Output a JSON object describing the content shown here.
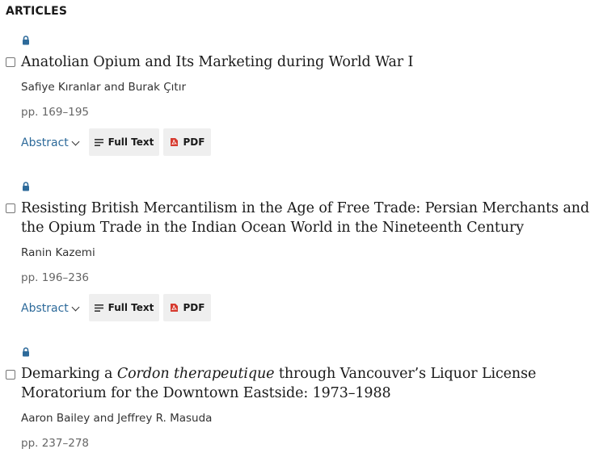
{
  "section": {
    "title": "ARTICLES"
  },
  "articles": [
    {
      "title": "Anatolian Opium and Its Marketing during World War I",
      "authors": "Safiye Kıranlar and Burak Çıtır",
      "pages": "pp. 169–195",
      "abstract_label": "Abstract",
      "fulltext_label": "Full Text",
      "pdf_label": "PDF"
    },
    {
      "title": "Resisting British Mercantilism in the Age of Free Trade: Persian Merchants and the Opium Trade in the Indian Ocean World in the Nineteenth Century",
      "authors": "Ranin Kazemi",
      "pages": "pp. 196–236",
      "abstract_label": "Abstract",
      "fulltext_label": "Full Text",
      "pdf_label": "PDF"
    },
    {
      "title_part1": "Demarking a ",
      "title_italic": "Cordon therapeutique",
      "title_part2": " through Vancouver’s Liquor License Moratorium for the Downtown Eastside: 1973–1988",
      "authors": "Aaron Bailey and Jeffrey R. Masuda",
      "pages": "pp. 237–278"
    }
  ],
  "icons": {
    "lock": "lock-icon",
    "checkbox": "checkbox",
    "abstract_toggle": "chevron-down-icon",
    "full_text": "lines-icon",
    "pdf": "pdf-icon"
  },
  "colors": {
    "lock": "#2d6a9a",
    "abstract_link": "#2d6a9a",
    "pdf_icon": "#d63a2f",
    "button_bg": "#efefef"
  }
}
